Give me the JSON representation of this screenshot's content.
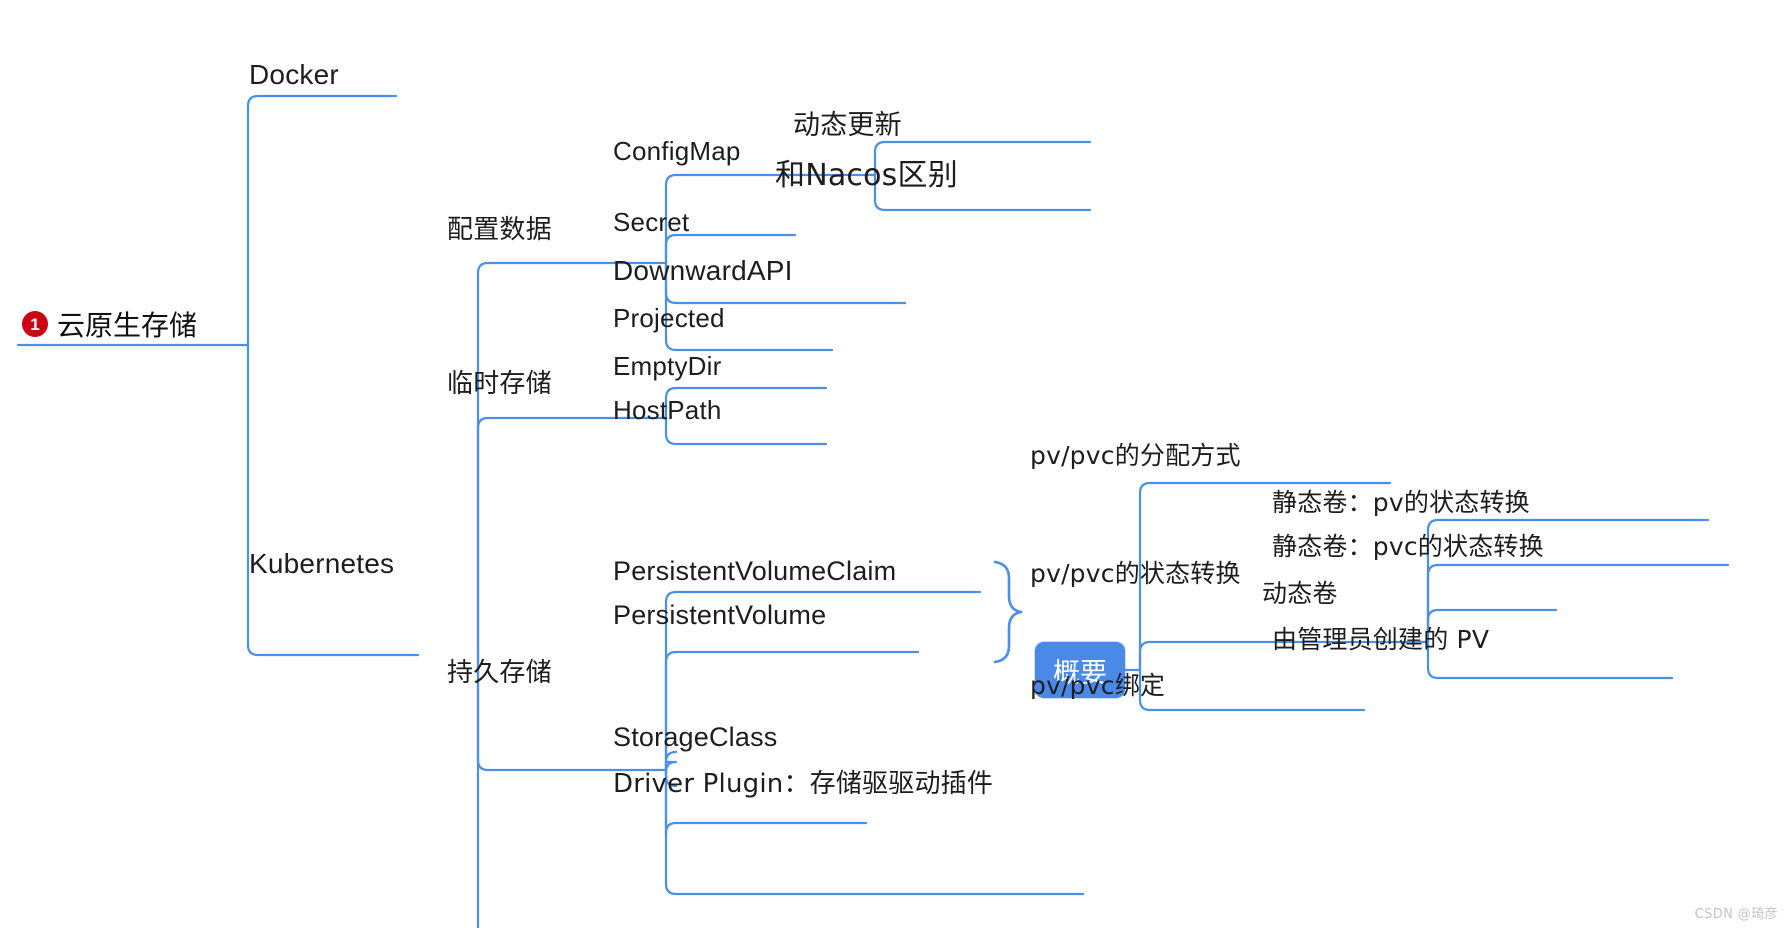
{
  "meta": {
    "watermark": "CSDN @琦彦",
    "line_color": "#4a90e8",
    "accent_color": "#4a89e8",
    "badge_color": "#cc0011",
    "text_color": "#1d1d1d",
    "background": "#ffffff"
  },
  "root": {
    "badge": "1",
    "label": "云原生存储"
  },
  "nodes": {
    "docker": "Docker",
    "kubernetes": "Kubernetes",
    "config_data": "配置数据",
    "configmap": "ConfigMap",
    "dynamic_update": "动态更新",
    "nacos_diff": "和Nacos区别",
    "secret": "Secret",
    "downward_api": "DownwardAPI",
    "projected": "Projected",
    "temp_storage": "临时存储",
    "emptydir": "EmptyDir",
    "hostpath": "HostPath",
    "persistent_storage": "持久存储",
    "pvc": "PersistentVolumeClaim",
    "pv": "PersistentVolume",
    "summary": "概要",
    "storageclass": "StorageClass",
    "driver_plugin": "Driver Plugin：存储驱驱动插件",
    "pv_pvc_alloc": "pv/pvc的分配方式",
    "pv_pvc_state": "pv/pvc的状态转换",
    "pv_pvc_bind": "pv/pvc绑定",
    "static_pv_state": "静态卷：pv的状态转换",
    "static_pvc_state": "静态卷：pvc的状态转换",
    "dynamic_volume": "动态卷",
    "admin_created_pv": "由管理员创建的 PV"
  }
}
